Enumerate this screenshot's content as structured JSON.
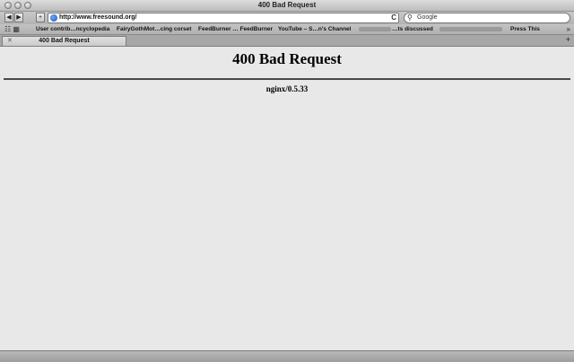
{
  "window": {
    "title": "400 Bad Request"
  },
  "toolbar": {
    "back_glyph": "◀",
    "forward_glyph": "▶",
    "add_glyph": "+",
    "url": "http://www.freesound.org/",
    "reload_glyph": "C",
    "search_placeholder": "Google"
  },
  "bookmarks": {
    "items": [
      "User contrib…ncyclopedia",
      "FairyGothMot…cing corset",
      "FeedBurner … FeedBurner",
      "YouTube – S…n's Channel",
      "…ts discussed",
      "Press This"
    ],
    "more_glyph": "»"
  },
  "tabs": [
    {
      "label": "400 Bad Request"
    }
  ],
  "page": {
    "heading": "400 Bad Request",
    "server": "nginx/0.5.33"
  }
}
